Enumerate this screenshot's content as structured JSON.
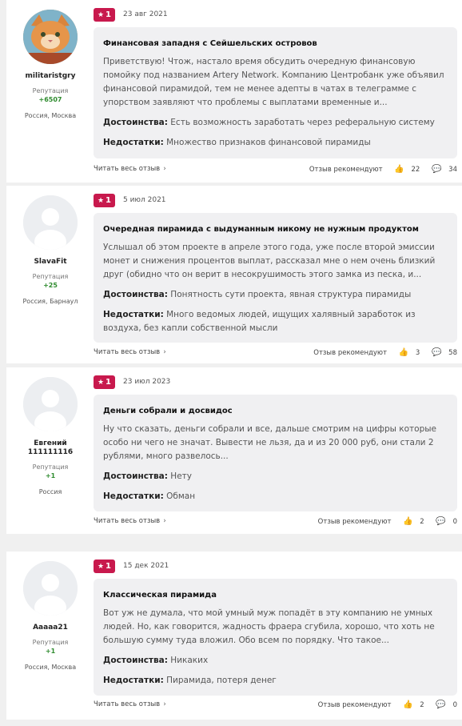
{
  "labels": {
    "pros": "Достоинства:",
    "cons": "Недостатки:",
    "read_more": "Читать весь отзыв",
    "recommends": "Отзыв рекомендуют",
    "reputation": "Репутация"
  },
  "reviews": [
    {
      "username": "militaristgry",
      "reputation": "+6507",
      "location": "Россия, Москва",
      "rating": "1",
      "date": "23 авг 2021",
      "title": "Финансовая западня с Сейшельских островов",
      "text": "Приветствую! Чтож, настало время обсудить очередную финансовую помойку под названием Artery Network. Компанию Центробанк уже объявил финансовой пирамидой, тем не менее адепты в чатах в телеграмме с упорством заявляют что проблемы с выплатами временные и...",
      "pros": "Есть возможность заработать через реферальную систему",
      "cons": "Множество признаков финансовой пирамиды",
      "likes": "22",
      "comments": "34"
    },
    {
      "username": "SlavaFit",
      "reputation": "+25",
      "location": "Россия, Барнаул",
      "rating": "1",
      "date": "5 июл 2021",
      "title": "Очередная пирамида с выдуманным никому не нужным продуктом",
      "text": "Услышал об этом проекте в апреле этого года, уже после второй эмиссии монет и снижения процентов выплат, рассказал мне о нем очень близкий друг (обидно что он верит в несокрушимость этого замка из песка, и...",
      "pros": "Понятность сути проекта, явная структура пирамиды",
      "cons": "Много ведомых людей, ищущих халявный заработок из воздуха, без капли собственной мысли",
      "likes": "3",
      "comments": "58"
    },
    {
      "username": "Евгений 111111116",
      "reputation": "+1",
      "location": "Россия",
      "rating": "1",
      "date": "23 июл 2023",
      "title": "Деньги собрали и досвидос",
      "text": "Ну что сказать, деньги собрали и все, дальше смотрим на цифры которые особо ни чего не значат. Вывести не льзя, да и из 20 000 руб, они стали 2 рублями, много развелось...",
      "pros": "Нету",
      "cons": "Обман",
      "likes": "2",
      "comments": "0"
    },
    {
      "username": "Aaaaa21",
      "reputation": "+1",
      "location": "Россия, Москва",
      "rating": "1",
      "date": "15 дек 2021",
      "title": "Классическая пирамида",
      "text": "Вот уж не думала, что мой умный муж попадёт в эту компанию не умных людей. Но, как говорится, жадность фраера сгубила, хорошо, что хоть не большую сумму туда вложил. Обо всем по порядку. Что такое...",
      "pros": "Никаких",
      "cons": "Пирамида, потеря денег",
      "likes": "2",
      "comments": "0"
    }
  ]
}
